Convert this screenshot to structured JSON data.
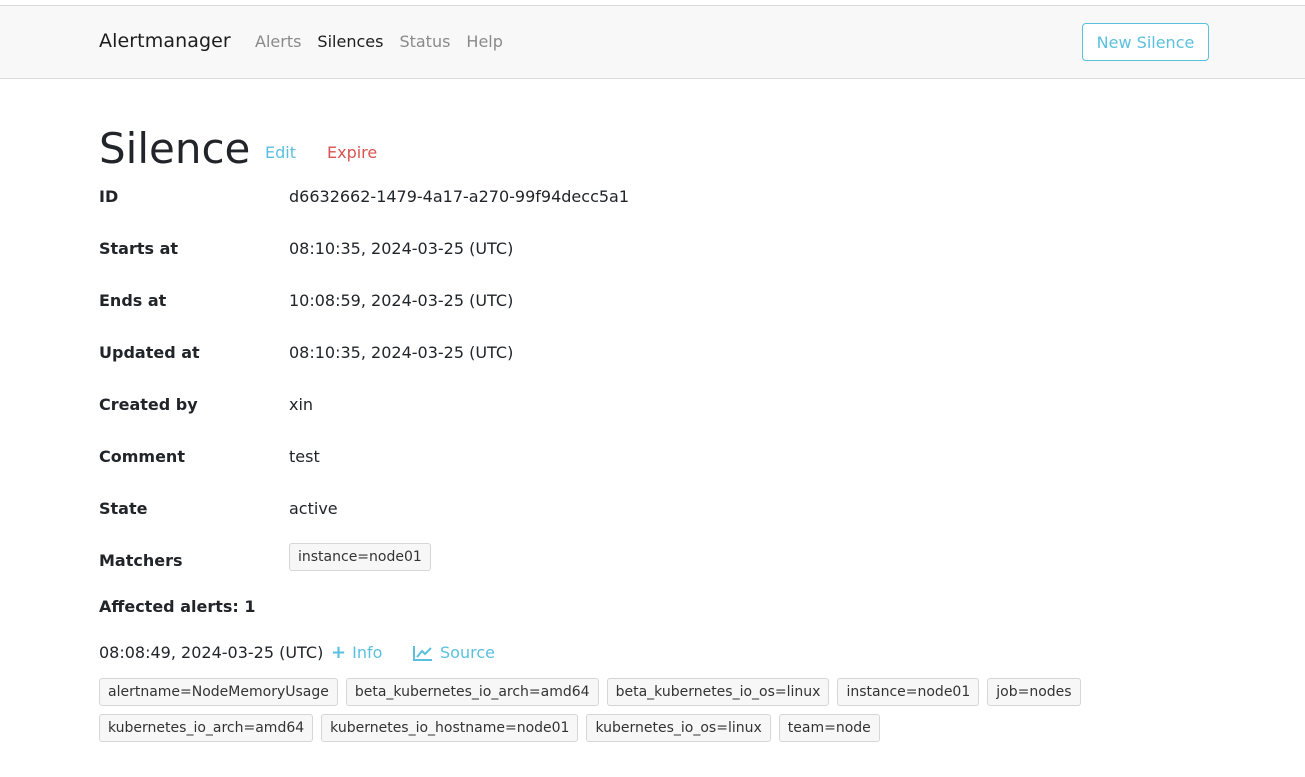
{
  "navbar": {
    "brand": "Alertmanager",
    "links": [
      {
        "label": "Alerts",
        "active": false
      },
      {
        "label": "Silences",
        "active": true
      },
      {
        "label": "Status",
        "active": false
      },
      {
        "label": "Help",
        "active": false
      }
    ],
    "new_silence_label": "New Silence"
  },
  "silence": {
    "title": "Silence",
    "edit_label": "Edit",
    "expire_label": "Expire",
    "fields": [
      {
        "label": "ID",
        "value": "d6632662-1479-4a17-a270-99f94decc5a1"
      },
      {
        "label": "Starts at",
        "value": "08:10:35, 2024-03-25 (UTC)"
      },
      {
        "label": "Ends at",
        "value": "10:08:59, 2024-03-25 (UTC)"
      },
      {
        "label": "Updated at",
        "value": "08:10:35, 2024-03-25 (UTC)"
      },
      {
        "label": "Created by",
        "value": "xin"
      },
      {
        "label": "Comment",
        "value": "test"
      },
      {
        "label": "State",
        "value": "active"
      }
    ],
    "matchers_label": "Matchers",
    "matchers": [
      "instance=node01"
    ]
  },
  "affected": {
    "heading": "Affected alerts: 1",
    "alert": {
      "time": "08:08:49, 2024-03-25 (UTC)",
      "info_label": "Info",
      "source_label": "Source",
      "labels_row1": [
        "alertname=NodeMemoryUsage",
        "beta_kubernetes_io_arch=amd64",
        "beta_kubernetes_io_os=linux",
        "instance=node01",
        "job=nodes"
      ],
      "labels_row2": [
        "kubernetes_io_arch=amd64",
        "kubernetes_io_hostname=node01",
        "kubernetes_io_os=linux",
        "team=node"
      ]
    }
  },
  "colors": {
    "accent": "#5bc0de",
    "danger": "#d9534f",
    "navbar_bg": "#f8f8f8"
  },
  "icons": {
    "info": "plus-icon",
    "source": "line-chart-icon"
  }
}
